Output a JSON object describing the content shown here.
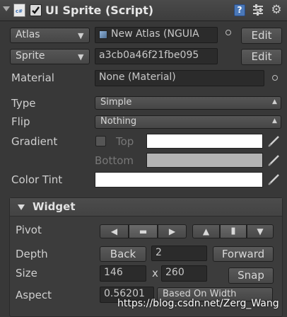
{
  "header": {
    "title": "UI Sprite (Script)",
    "enabled": true,
    "icons": [
      "script-icon",
      "help-icon",
      "preset-icon",
      "settings-icon"
    ]
  },
  "atlas": {
    "label": "Atlas",
    "value": "New Atlas (NGUIA",
    "edit_label": "Edit"
  },
  "sprite": {
    "label": "Sprite",
    "value": "a3cb0a46f21fbe095",
    "edit_label": "Edit"
  },
  "material": {
    "label": "Material",
    "value": "None (Material)"
  },
  "type": {
    "label": "Type",
    "value": "Simple"
  },
  "flip": {
    "label": "Flip",
    "value": "Nothing"
  },
  "gradient": {
    "label": "Gradient",
    "enabled": false,
    "top_label": "Top",
    "bottom_label": "Bottom",
    "top_color": "#ffffff",
    "bottom_color": "#b4b4b4"
  },
  "color_tint": {
    "label": "Color Tint",
    "color": "#ffffff"
  },
  "widget": {
    "title": "Widget",
    "pivot_label": "Pivot",
    "pivot_buttons": [
      "◀",
      "▬",
      "▶",
      "▲",
      "▮",
      "▼"
    ],
    "depth_label": "Depth",
    "back_label": "Back",
    "depth_value": "2",
    "forward_label": "Forward",
    "size_label": "Size",
    "width": "146",
    "x_separator": "x",
    "height": "260",
    "snap_label": "Snap",
    "aspect_label": "Aspect",
    "aspect_value": "0.56201",
    "aspect_mode": "Based On Width"
  },
  "watermark": "https://blog.csdn.net/Zerg_Wang",
  "colors": {
    "background": "#383838",
    "field": "#2b2b2b",
    "section": "#454545"
  }
}
